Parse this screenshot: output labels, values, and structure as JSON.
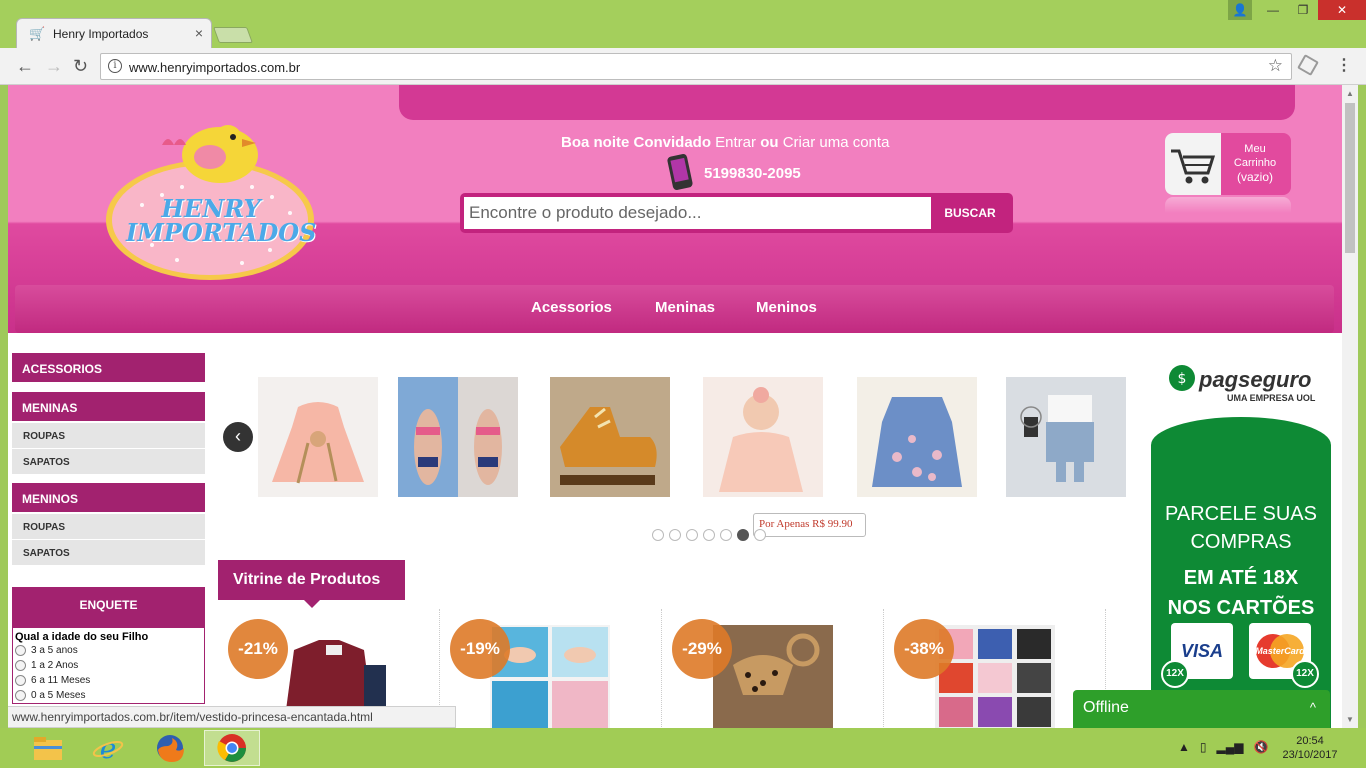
{
  "browser": {
    "tab_title": "Henry Importados",
    "url": "www.henryimportados.com.br",
    "status_url": "www.henryimportados.com.br/item/vestido-princesa-encantada.html"
  },
  "header": {
    "logo_text": "HENRY IMPORTADOS",
    "greeting": "Boa noite Convidado",
    "login": "Entrar",
    "or": "ou",
    "register": "Criar uma conta",
    "phone": "5199830-2095",
    "search_placeholder": "Encontre o produto desejado...",
    "search_button": "BUSCAR",
    "cart_line1": "Meu",
    "cart_line2": "Carrinho",
    "cart_line3": "(vazio)"
  },
  "nav": [
    "Acessorios",
    "Meninas",
    "Meninos"
  ],
  "sidebar": {
    "acessorios": "ACESSORIOS",
    "meninas": "MENINAS",
    "meninas_sub": [
      "ROUPAS",
      "SAPATOS"
    ],
    "meninos": "MENINOS",
    "meninos_sub": [
      "ROUPAS",
      "SAPATOS"
    ]
  },
  "poll": {
    "title": "ENQUETE",
    "question": "Qual a idade do seu Filho",
    "options": [
      "3 a 5 anos",
      "1 a 2 Anos",
      "6 a 11 Meses",
      "0 a 5 Meses"
    ]
  },
  "carousel": {
    "prev_glyph": "‹",
    "price_tooltip": "Por Apenas R$ 99.90",
    "dots": 7,
    "active_dot": 6
  },
  "vitrine": {
    "title": "Vitrine de Produtos",
    "discounts": [
      "-21%",
      "-19%",
      "-29%",
      "-38%"
    ]
  },
  "ad": {
    "brand": "pagseguro",
    "brand_sub": "UMA EMPRESA UOL",
    "line1a": "PARCELE SUAS",
    "line1b": "COMPRAS",
    "line2a": "EM ATÉ 18X",
    "line2b": "NOS CARTÕES",
    "card1": "VISA",
    "card2": "MasterCard",
    "badge": "12X"
  },
  "chat": {
    "label": "Offline",
    "caret": "^"
  },
  "clock": {
    "time": "20:54",
    "date": "23/10/2017"
  },
  "colors": {
    "accent": "#a2226f",
    "pink": "#f27fbf",
    "green": "#0e8a35"
  }
}
